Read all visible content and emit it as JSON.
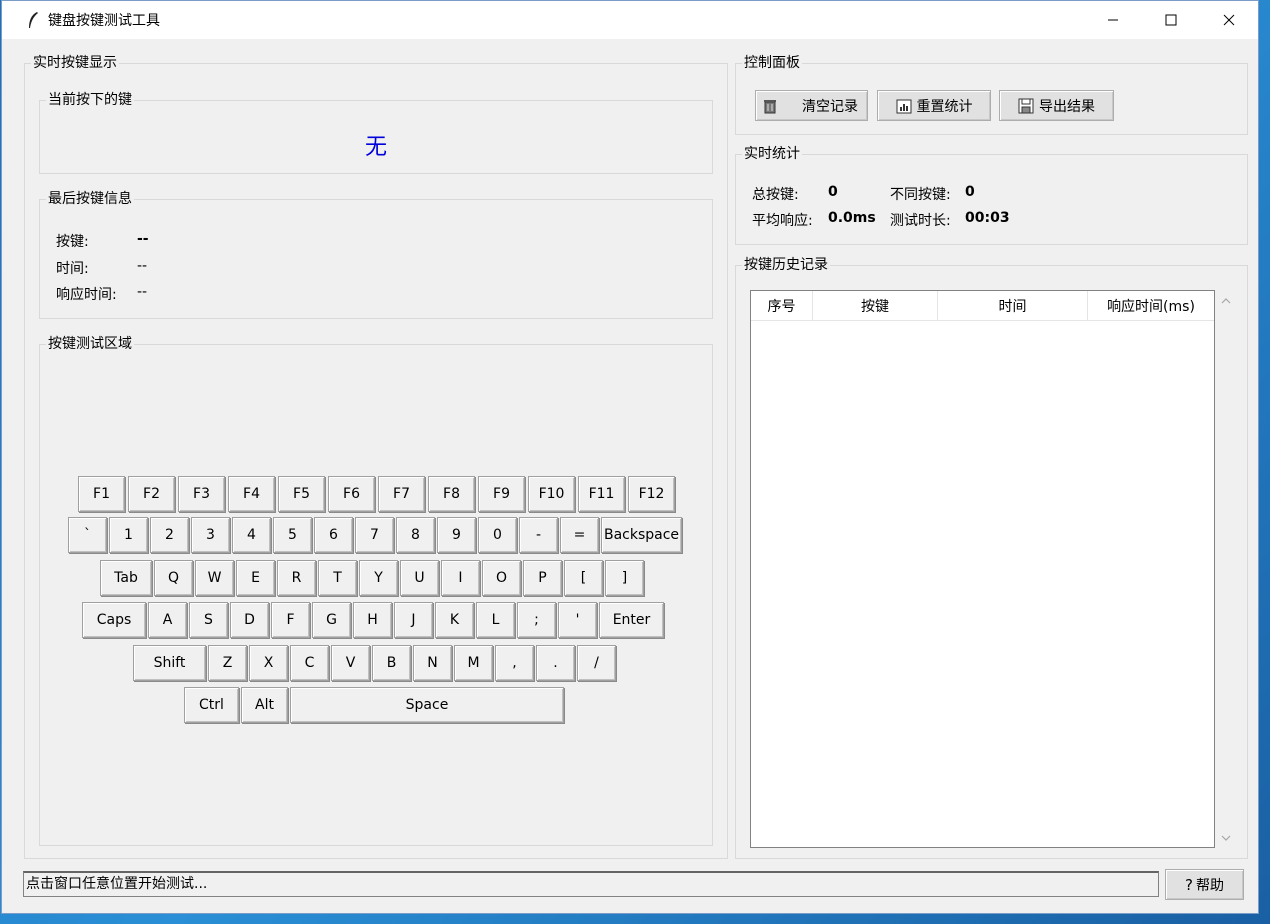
{
  "window": {
    "title": "键盘按键测试工具",
    "icon": "feather-icon"
  },
  "live_display": {
    "label": "实时按键显示",
    "current_key": {
      "label": "当前按下的键",
      "value": "无"
    },
    "last_key": {
      "label": "最后按键信息",
      "key_label": "按键:",
      "key_value": "--",
      "time_label": "时间:",
      "time_value": "--",
      "response_label": "响应时间:",
      "response_value": "--"
    }
  },
  "keyboard": {
    "label": "按键测试区域",
    "rows": [
      [
        "F1",
        "F2",
        "F3",
        "F4",
        "F5",
        "F6",
        "F7",
        "F8",
        "F9",
        "F10",
        "F11",
        "F12"
      ],
      [
        "`",
        "1",
        "2",
        "3",
        "4",
        "5",
        "6",
        "7",
        "8",
        "9",
        "0",
        "-",
        "=",
        "Backspace"
      ],
      [
        "Tab",
        "Q",
        "W",
        "E",
        "R",
        "T",
        "Y",
        "U",
        "I",
        "O",
        "P",
        "[",
        "]"
      ],
      [
        "Caps",
        "A",
        "S",
        "D",
        "F",
        "G",
        "H",
        "J",
        "K",
        "L",
        ";",
        "'",
        "Enter"
      ],
      [
        "Shift",
        "Z",
        "X",
        "C",
        "V",
        "B",
        "N",
        "M",
        ",",
        ".",
        "/"
      ],
      [
        "Ctrl",
        "Alt",
        "Space"
      ]
    ]
  },
  "control": {
    "label": "控制面板",
    "clear_label": "清空记录",
    "reset_label": "重置统计",
    "export_label": "导出结果"
  },
  "stats": {
    "label": "实时统计",
    "total_label": "总按键:",
    "total_value": "0",
    "unique_label": "不同按键:",
    "unique_value": "0",
    "avg_label": "平均响应:",
    "avg_value": "0.0ms",
    "duration_label": "测试时长:",
    "duration_value": "00:03"
  },
  "history": {
    "label": "按键历史记录",
    "columns": [
      "序号",
      "按键",
      "时间",
      "响应时间(ms)"
    ],
    "rows": []
  },
  "status": {
    "text": "点击窗口任意位置开始测试...",
    "help_label": "帮助"
  }
}
